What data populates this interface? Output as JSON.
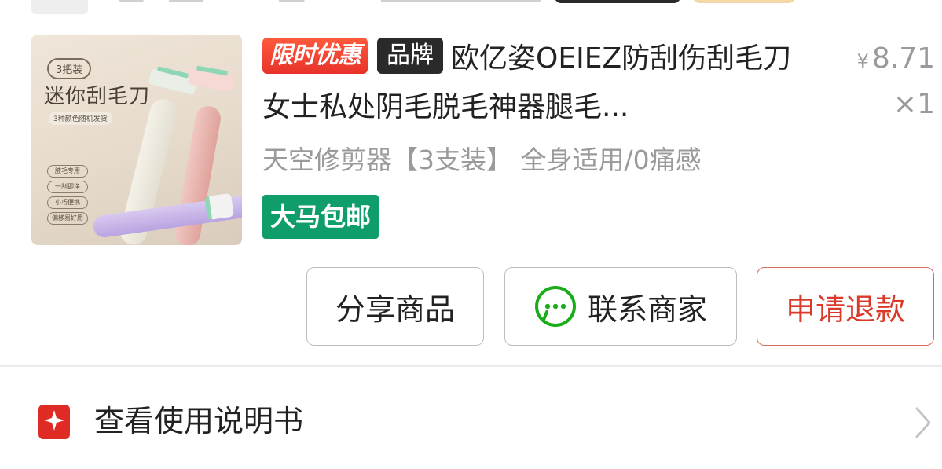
{
  "product": {
    "thumbnail": {
      "pack_label": "3把装",
      "title": "迷你刮毛刀",
      "subtitle": "3种颜色随机发货",
      "tags": [
        "腋毛专用",
        "一刮即净",
        "小巧便携",
        "偏移易好用"
      ]
    },
    "badges": {
      "limited_offer": "限时优惠",
      "brand": "品牌"
    },
    "title": "欧亿姿OEIEZ防刮伤刮毛刀女士私处阴毛脱毛神器腿毛...",
    "spec": "天空修剪器【3支装】 全身适用/0痛感",
    "shipping_badge": "大马包邮",
    "price_symbol": "¥",
    "price": "8.71",
    "quantity": "×1"
  },
  "actions": {
    "share_label": "分享商品",
    "contact_label": "联系商家",
    "refund_label": "申请退款"
  },
  "manual": {
    "label": "查看使用说明书",
    "icon": "manual-icon"
  },
  "colors": {
    "limited_badge": "#e8322a",
    "brand_badge": "#2a2a2a",
    "shipping_badge": "#0f9d6a",
    "refund_text": "#d93a2a",
    "wechat_green": "#1aad19"
  }
}
